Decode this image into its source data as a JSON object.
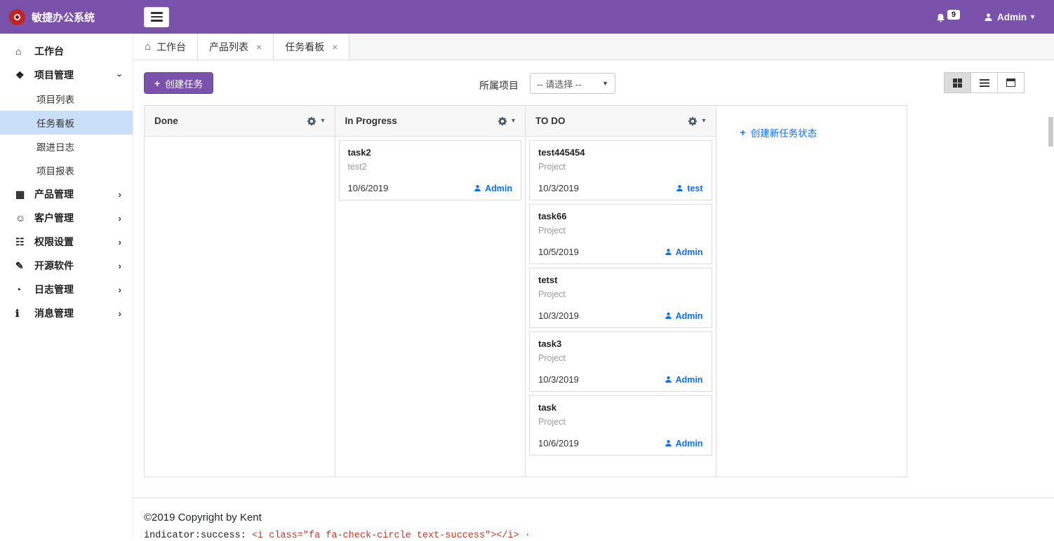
{
  "topbar": {
    "app_title": "敏捷办公系统",
    "notification_count": "9",
    "user_name": "Admin"
  },
  "sidebar": {
    "items": [
      {
        "id": "workbench",
        "label": "工作台",
        "icon": "home-icon"
      },
      {
        "id": "project",
        "label": "项目管理",
        "icon": "project-icon",
        "expanded": true,
        "children": [
          {
            "id": "project-list",
            "label": "项目列表"
          },
          {
            "id": "task-board",
            "label": "任务看板",
            "active": true
          },
          {
            "id": "follow-log",
            "label": "跟进日志"
          },
          {
            "id": "project-report",
            "label": "项目报表"
          }
        ]
      },
      {
        "id": "product",
        "label": "产品管理",
        "icon": "product-icon",
        "collapsed": true
      },
      {
        "id": "customer",
        "label": "客户管理",
        "icon": "customer-icon",
        "collapsed": true
      },
      {
        "id": "permission",
        "label": "权限设置",
        "icon": "permission-icon",
        "collapsed": true
      },
      {
        "id": "opensource",
        "label": "开源软件",
        "icon": "software-icon",
        "collapsed": true
      },
      {
        "id": "log",
        "label": "日志管理",
        "icon": "log-icon",
        "collapsed": true
      },
      {
        "id": "message",
        "label": "消息管理",
        "icon": "message-icon",
        "collapsed": true
      }
    ]
  },
  "tabs": [
    {
      "id": "workbench",
      "label": "工作台",
      "icon": "home-icon",
      "closable": false
    },
    {
      "id": "product-list",
      "label": "产品列表",
      "closable": true
    },
    {
      "id": "task-board",
      "label": "任务看板",
      "closable": true,
      "active": true
    }
  ],
  "toolbar": {
    "create_task_label": "创建任务",
    "project_filter_label": "所属项目",
    "project_select_value": "-- 请选择 --"
  },
  "board": {
    "columns": [
      {
        "title": "Done",
        "cards": []
      },
      {
        "title": "In Progress",
        "cards": [
          {
            "title": "task2",
            "subtitle": "test2",
            "date": "10/6/2019",
            "assignee": "Admin"
          }
        ]
      },
      {
        "title": "TO DO",
        "cards": [
          {
            "title": "test445454",
            "subtitle": "Project",
            "date": "10/3/2019",
            "assignee": "test"
          },
          {
            "title": "task66",
            "subtitle": "Project",
            "date": "10/5/2019",
            "assignee": "Admin"
          },
          {
            "title": "tetst",
            "subtitle": "Project",
            "date": "10/3/2019",
            "assignee": "Admin"
          },
          {
            "title": "task3",
            "subtitle": "Project",
            "date": "10/3/2019",
            "assignee": "Admin"
          },
          {
            "title": "task",
            "subtitle": "Project",
            "date": "10/6/2019",
            "assignee": "Admin"
          }
        ]
      }
    ],
    "add_status_label": "创建新任务状态"
  },
  "footer": {
    "copyright": "©2019 Copyright by Kent"
  },
  "bottom_strip": {
    "prefix": "indicator:success:",
    "code": "<i class=\"fa fa-check-circle text-success\"></i> ·"
  },
  "colors": {
    "primary": "#7a52ab",
    "link": "#0d6efd",
    "active_item_bg": "#c9e0f8",
    "logo_red": "#c12525"
  }
}
